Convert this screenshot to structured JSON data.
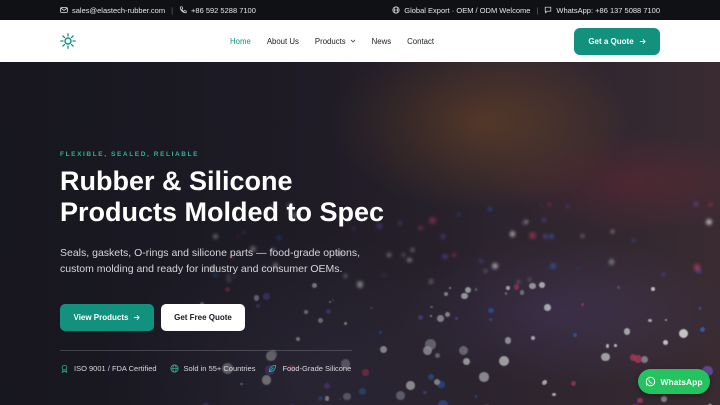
{
  "topbar": {
    "email": "sales@elastech-rubber.com",
    "phone": "+86 592 5288 7100",
    "export_text": "Global Export · OEM / ODM Welcome",
    "whatsapp_text": "WhatsApp: +86 137 5088 7100",
    "icons": [
      "mail-icon",
      "phone-icon",
      "globe-icon",
      "chat-icon"
    ]
  },
  "nav": {
    "items": [
      {
        "label": "Home",
        "active": true
      },
      {
        "label": "About Us"
      },
      {
        "label": "Products",
        "dropdown": true
      },
      {
        "label": "News"
      },
      {
        "label": "Contact"
      }
    ],
    "cta": "Get a Quote"
  },
  "hero": {
    "eyebrow": "FLEXIBLE, SEALED, RELIABLE",
    "title_line1": "Rubber & Silicone",
    "title_line2": "Products Molded to Spec",
    "lead": "Seals, gaskets, O-rings and silicone parts — food-grade options, custom molding and ready for industry and consumer OEMs.",
    "primary_button": "View Products",
    "secondary_button": "Get Free Quote",
    "badges": [
      {
        "label": "ISO 9001 / FDA Certified",
        "icon": "award-icon"
      },
      {
        "label": "Sold in 55+ Countries",
        "icon": "globe-icon"
      },
      {
        "label": "Food-Grade Silicone",
        "icon": "leaf-icon"
      }
    ]
  },
  "whatsapp_button": "WhatsApp",
  "colors": {
    "accent": "#13917f",
    "eyebrow": "#2db39d",
    "topbar_bg": "#0f1115",
    "whatsapp": "#25c35f"
  }
}
